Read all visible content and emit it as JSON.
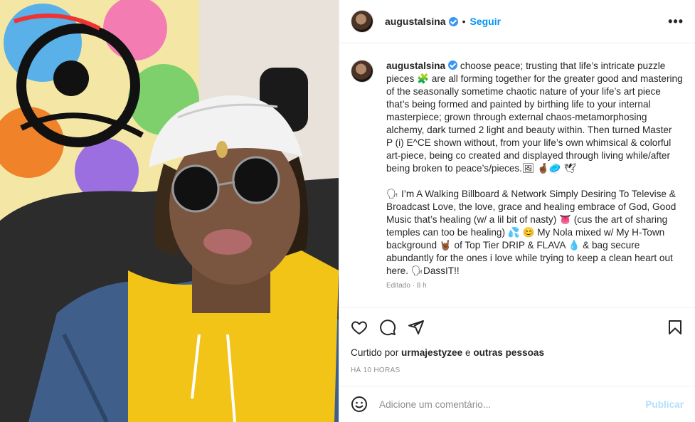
{
  "post": {
    "username": "augustalsina",
    "separator": "•",
    "follow_label": "Seguir",
    "more_label": "•••",
    "caption": "choose peace; trusting that life’s intricate puzzle pieces 🧩 are all forming together for the greater good and mastering of the seasonally sometime chaotic nature of your life’s art piece that’s being formed and painted by birthing life to your internal masterpiece; grown through external chaos-metamorphosing alchemy, dark turned 2 light and beauty within. Then turned Master\nP (i) E^CE shown without, from your life’s own whimsical & colorful art-piece, being co created and displayed through living while/after being broken to peace’s/pieces.🖼 🤞🏾🥏 🕊\n\n🗣 I’m A Walking Billboard & Network Simply Desiring To Televise & Broadcast Love, the love, grace and healing embrace of God, Good Music that’s healing (w/ a lil bit of nasty) 👅 (cus the art of sharing temples can too be healing) 💦 😊 My Nola mixed w/ My H-Town background 🤘🏾 of Top Tier DRIP & FLAVA 💧 & bag secure abundantly for the ones i love while trying to keep a clean heart out here. 🗣DassIT!!",
    "edited_label": "Editado · 8 h",
    "liked_prefix": "Curtido por ",
    "liked_user": "urmajestyzee",
    "liked_mid": " e ",
    "liked_others": "outras pessoas",
    "time": "HÁ 10 HORAS",
    "comment_placeholder": "Adicione um comentário...",
    "publish_label": "Publicar"
  },
  "icons": {
    "verified": "verified-badge-icon",
    "like": "heart-icon",
    "comment": "comment-icon",
    "share": "send-icon",
    "save": "bookmark-icon",
    "emoji": "smiley-icon",
    "more": "more-options-icon"
  },
  "colors": {
    "link_blue": "#0095f6",
    "verified_blue": "#3897f0",
    "publish_disabled": "#b2dffc",
    "hoodie_yellow": "#f2c418"
  }
}
